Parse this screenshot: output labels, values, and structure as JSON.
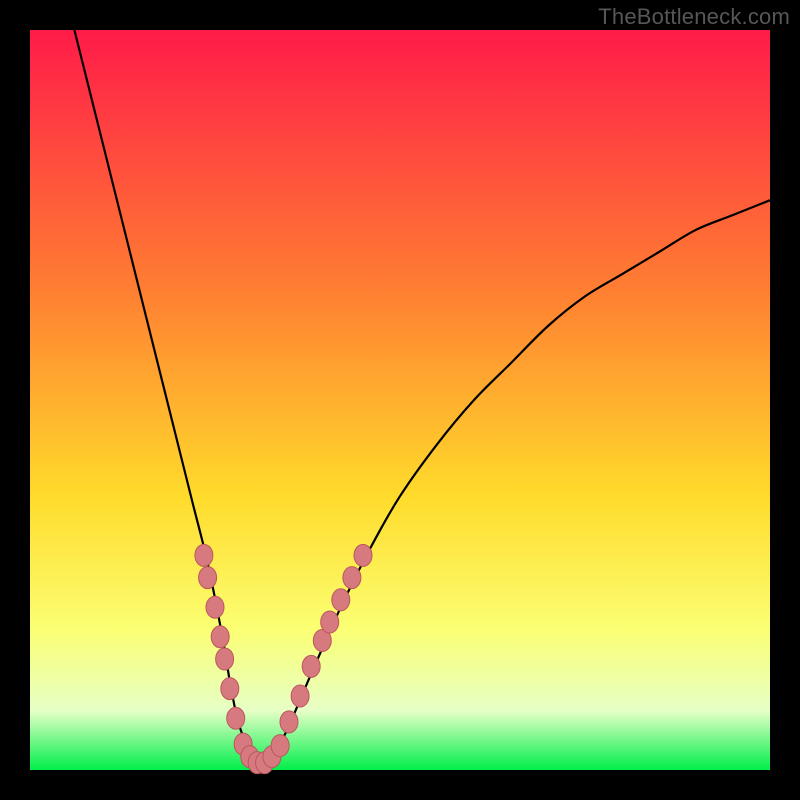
{
  "watermark": "TheBottleneck.com",
  "colors": {
    "frame": "#000000",
    "gradient_top": "#ff1b49",
    "gradient_mid_upper": "#ff7e32",
    "gradient_mid": "#ffdb2b",
    "gradient_mid_lower": "#fbff73",
    "gradient_band": "#e6ffc6",
    "gradient_bottom": "#00ef4b",
    "curve": "#000000",
    "marker_fill": "#d77a7f",
    "marker_stroke": "#bb575e"
  },
  "chart_data": {
    "type": "line",
    "title": "",
    "xlabel": "",
    "ylabel": "",
    "xlim": [
      0,
      100
    ],
    "ylim": [
      0,
      100
    ],
    "series": [
      {
        "name": "bottleneck-curve",
        "x": [
          6,
          8,
          10,
          12,
          14,
          16,
          18,
          20,
          22,
          24,
          26,
          27,
          28,
          29,
          30,
          31,
          32,
          33,
          35,
          38,
          42,
          46,
          50,
          55,
          60,
          65,
          70,
          75,
          80,
          85,
          90,
          95,
          100
        ],
        "y": [
          100,
          92,
          84,
          76,
          68,
          60,
          52,
          44,
          36,
          28,
          18,
          12,
          7,
          4,
          2,
          1,
          1,
          2,
          6,
          13,
          22,
          30,
          37,
          44,
          50,
          55,
          60,
          64,
          67,
          70,
          73,
          75,
          77
        ]
      }
    ],
    "markers": {
      "name": "highlight-points",
      "points": [
        {
          "x": 23.5,
          "y": 29
        },
        {
          "x": 24.0,
          "y": 26
        },
        {
          "x": 25.0,
          "y": 22
        },
        {
          "x": 25.7,
          "y": 18
        },
        {
          "x": 26.3,
          "y": 15
        },
        {
          "x": 27.0,
          "y": 11
        },
        {
          "x": 27.8,
          "y": 7
        },
        {
          "x": 28.8,
          "y": 3.5
        },
        {
          "x": 29.7,
          "y": 1.8
        },
        {
          "x": 30.7,
          "y": 1
        },
        {
          "x": 31.7,
          "y": 1
        },
        {
          "x": 32.7,
          "y": 1.8
        },
        {
          "x": 33.8,
          "y": 3.3
        },
        {
          "x": 35.0,
          "y": 6.5
        },
        {
          "x": 36.5,
          "y": 10
        },
        {
          "x": 38.0,
          "y": 14
        },
        {
          "x": 39.5,
          "y": 17.5
        },
        {
          "x": 40.5,
          "y": 20
        },
        {
          "x": 42.0,
          "y": 23
        },
        {
          "x": 43.5,
          "y": 26
        },
        {
          "x": 45.0,
          "y": 29
        }
      ]
    },
    "minimum_at_x": 31
  }
}
